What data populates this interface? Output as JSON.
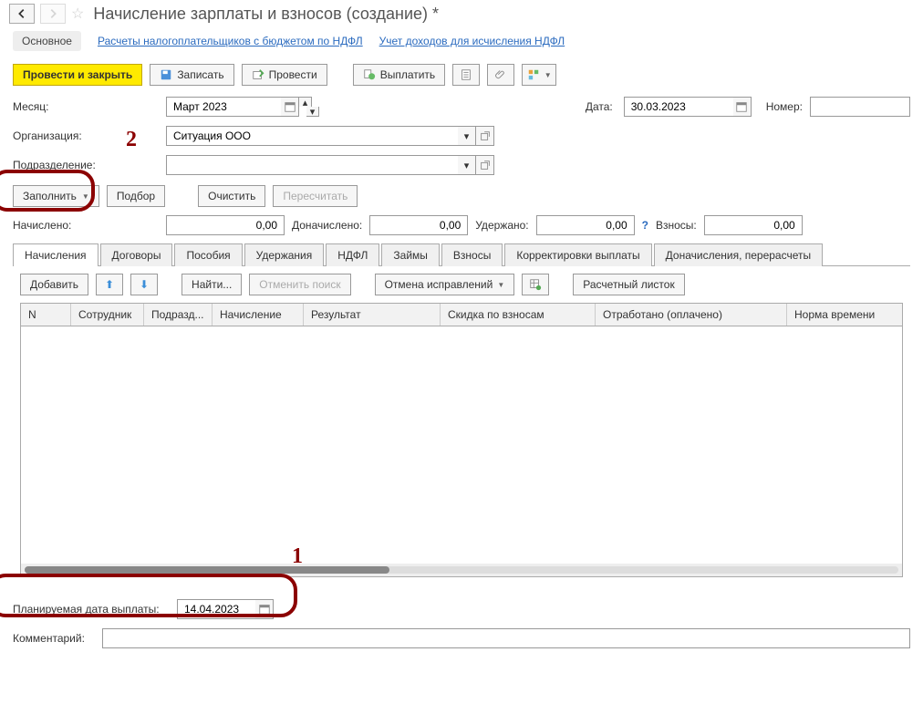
{
  "header": {
    "title": "Начисление зарплаты и взносов (создание) *"
  },
  "linkbar": {
    "main": "Основное",
    "link1": "Расчеты налогоплательщиков с бюджетом по НДФЛ",
    "link2": "Учет доходов для исчисления НДФЛ"
  },
  "toolbar": {
    "postClose": "Провести и закрыть",
    "save": "Записать",
    "post": "Провести",
    "pay": "Выплатить"
  },
  "fields": {
    "monthLabel": "Месяц:",
    "monthValue": "Март 2023",
    "dateLabel": "Дата:",
    "dateValue": "30.03.2023",
    "numberLabel": "Номер:",
    "numberValue": "",
    "orgLabel": "Организация:",
    "orgValue": "Ситуация ООО",
    "divisionLabel": "Подразделение:",
    "divisionValue": ""
  },
  "fillrow": {
    "fill": "Заполнить",
    "pick": "Подбор",
    "clear": "Очистить",
    "recalc": "Пересчитать"
  },
  "totals": {
    "accruedLabel": "Начислено:",
    "accruedValue": "0,00",
    "addAccruedLabel": "Доначислено:",
    "addAccruedValue": "0,00",
    "withheldLabel": "Удержано:",
    "withheldValue": "0,00",
    "feesLabel": "Взносы:",
    "feesValue": "0,00"
  },
  "tabs": {
    "t0": "Начисления",
    "t1": "Договоры",
    "t2": "Пособия",
    "t3": "Удержания",
    "t4": "НДФЛ",
    "t5": "Займы",
    "t6": "Взносы",
    "t7": "Корректировки выплаты",
    "t8": "Доначисления, перерасчеты"
  },
  "subtoolbar": {
    "add": "Добавить",
    "find": "Найти...",
    "cancelFind": "Отменить поиск",
    "cancelFix": "Отмена исправлений",
    "payslip": "Расчетный листок"
  },
  "table": {
    "col0": "N",
    "col1": "Сотрудник",
    "col2": "Подразд...",
    "col3": "Начисление",
    "col4": "Результат",
    "col5": "Скидка по взносам",
    "col6": "Отработано (оплачено)",
    "col7": "Норма времени"
  },
  "footer": {
    "planDateLabel": "Планируемая дата выплаты:",
    "planDateValue": "14.04.2023",
    "commentLabel": "Комментарий:"
  },
  "annotations": {
    "n1": "1",
    "n2": "2"
  }
}
